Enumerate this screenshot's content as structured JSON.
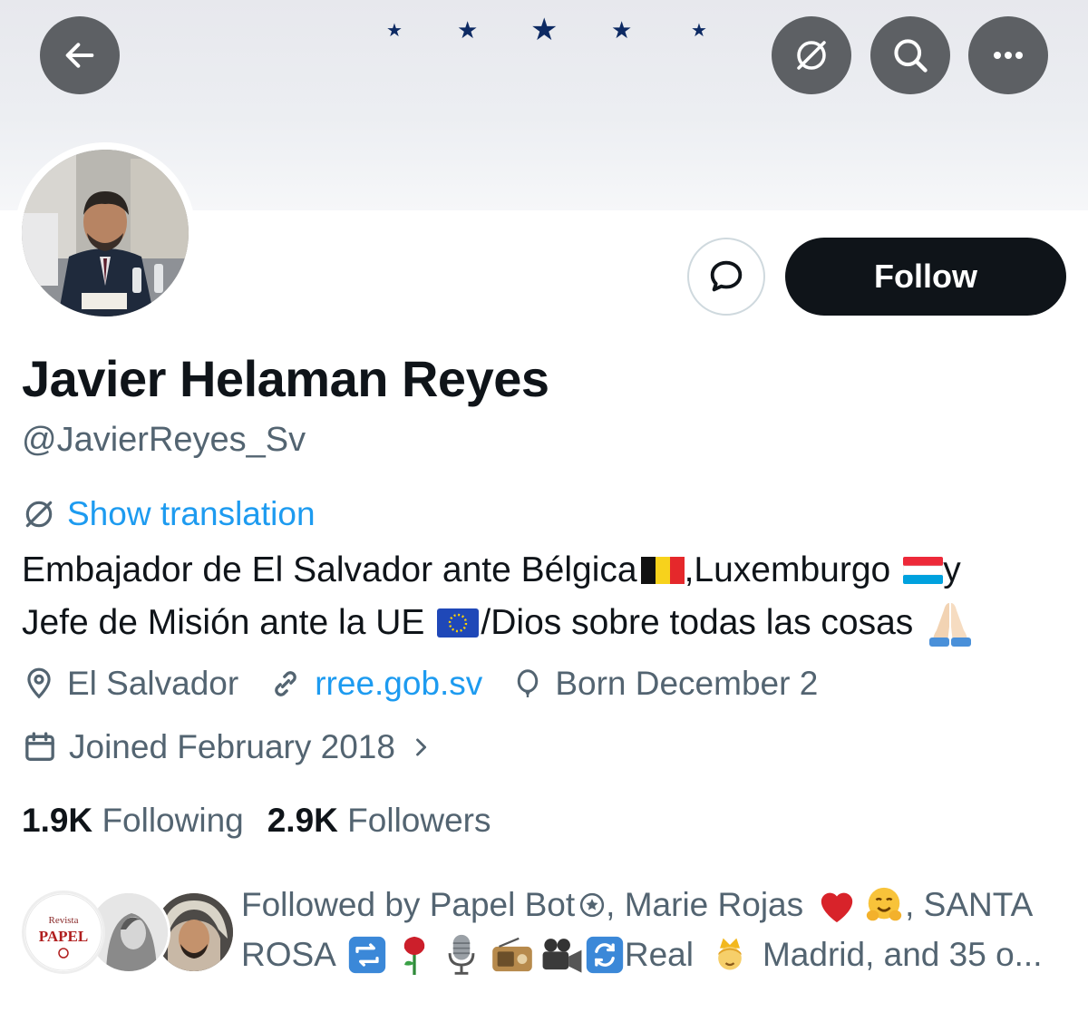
{
  "header": {
    "back_icon": "arrow-left-icon",
    "translate_icon": "globe-slash-icon",
    "search_icon": "search-icon",
    "more_icon": "ellipsis-icon",
    "banner_color": "#e7e8ed",
    "star_color": "#0d2a63"
  },
  "profile": {
    "name": "Javier Helaman Reyes",
    "handle": "@JavierReyes_Sv",
    "follow_label": "Follow",
    "show_translation": "Show translation",
    "bio_line1_a": "Embajador de El Salvador ante Bélgica",
    "bio_line1_b": ",Luxemburgo",
    "bio_line1_c": " y",
    "bio_line2_a": "Jefe de Misión ante la UE",
    "bio_line2_b": "/Dios sobre todas las cosas",
    "location": "El Salvador",
    "website": "rree.gob.sv",
    "birthday": "Born December 2",
    "joined": "Joined February 2018"
  },
  "stats": {
    "following_count": "1.9K",
    "following_label": "Following",
    "followers_count": "2.9K",
    "followers_label": "Followers"
  },
  "followed_by": {
    "line1_a": "Followed by Papel Bot",
    "line1_b": ", Marie Rojas",
    "line1_c": ", SANTA",
    "line2_a": "ROSA",
    "line2_b": "Real",
    "line2_c": "Madrid, and 35 o...",
    "avatar1_word1": "Revista",
    "avatar1_word2": "PAPEL"
  },
  "colors": {
    "accent": "#1d9bf0",
    "text_primary": "#0f1419",
    "text_secondary": "#536471",
    "follow_button": "#0f1419"
  }
}
